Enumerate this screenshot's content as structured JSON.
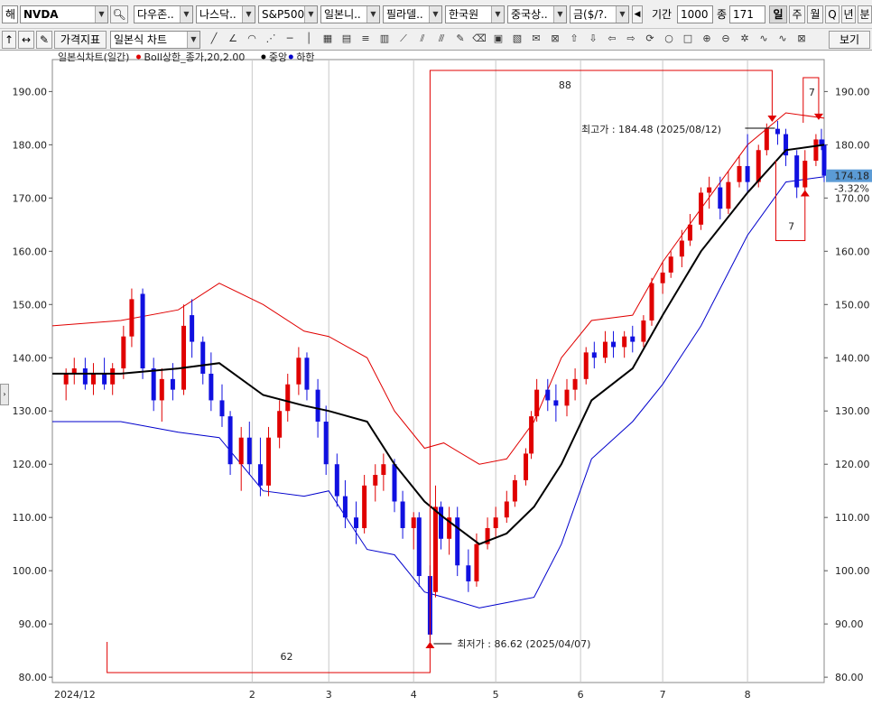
{
  "toolbar": {
    "prefix": "해",
    "symbol": "NVDA",
    "index_dropdowns": [
      "다우존..",
      "나스닥..",
      "S&P500",
      "일본니..",
      "필라델..",
      "한국원",
      "중국상..",
      "금($/?."
    ],
    "period_label": "기간",
    "period_value": "1000",
    "count_label": "종",
    "count_value": "171",
    "timeframes": [
      "일",
      "주",
      "월",
      "Q",
      "년",
      "분"
    ],
    "selected_timeframe": "일",
    "indicator_button": "가격지표",
    "chart_type": "일본식 차트",
    "view_button": "보기"
  },
  "chart_data": {
    "type": "candlestick",
    "legend_title": "일본식차트(일간)",
    "legend": [
      {
        "name": "Boll상한_종가,20,2.00",
        "color": "#e00000"
      },
      {
        "name": "중앙",
        "color": "#000000"
      },
      {
        "name": "하한",
        "color": "#0000cc"
      }
    ],
    "ylim": [
      79,
      196
    ],
    "y_ticks": [
      "190.00",
      "180.00",
      "170.00",
      "160.00",
      "150.00",
      "140.00",
      "130.00",
      "120.00",
      "110.00",
      "100.00",
      "90.00",
      "80.00"
    ],
    "x_tick_labels": [
      "2024/12",
      "2",
      "3",
      "4",
      "5",
      "6",
      "7",
      "8"
    ],
    "x_tick_dates": [
      "2024-12-01",
      "2025-02-01",
      "2025-03-01",
      "2025-04-01",
      "2025-05-01",
      "2025-06-01",
      "2025-07-01",
      "2025-08-01"
    ],
    "x_range": [
      "2024-11-20",
      "2025-08-29"
    ],
    "last_price": "174.18",
    "last_change": "-3.32%",
    "last_price_value": 174.18,
    "colors": {
      "up": "#e00000",
      "down": "#1010e0",
      "mid": "#000000",
      "upper": "#e00000",
      "lower": "#0000cc",
      "price_box": "#5b9bd5",
      "change": "#3a5fcd"
    },
    "annotations": {
      "high_label": "최고가 : 184.48 (2025/08/12)",
      "high_value": 184.48,
      "high_date": "2025-08-12",
      "low_label": "최저가 : 86.62 (2025/04/07)",
      "low_value": 86.62,
      "low_date": "2025-04-07",
      "count_top": "88",
      "count_bottom": "62",
      "count_right_top": "7",
      "count_right_bottom": "7"
    },
    "bollinger": {
      "dates": [
        "2024-11-20",
        "2024-12-15",
        "2025-01-05",
        "2025-01-20",
        "2025-02-05",
        "2025-02-20",
        "2025-03-01",
        "2025-03-15",
        "2025-03-25",
        "2025-04-05",
        "2025-04-12",
        "2025-04-25",
        "2025-05-05",
        "2025-05-15",
        "2025-05-25",
        "2025-06-05",
        "2025-06-20",
        "2025-07-01",
        "2025-07-15",
        "2025-08-01",
        "2025-08-15",
        "2025-08-29"
      ],
      "upper": [
        146,
        147,
        149,
        154,
        150,
        145,
        144,
        140,
        130,
        123,
        124,
        120,
        121,
        128,
        140,
        147,
        148,
        158,
        168,
        180,
        186,
        185
      ],
      "middle": [
        137,
        137,
        138,
        139,
        133,
        131,
        130,
        128,
        120,
        113,
        110,
        105,
        107,
        112,
        120,
        132,
        138,
        148,
        160,
        171,
        179,
        180
      ],
      "lower": [
        128,
        128,
        126,
        125,
        115,
        114,
        115,
        104,
        103,
        96,
        95,
        93,
        94,
        95,
        105,
        121,
        128,
        135,
        146,
        163,
        173,
        174
      ]
    },
    "candles": [
      {
        "d": "2024-11-25",
        "o": 135,
        "h": 138,
        "l": 132,
        "c": 137
      },
      {
        "d": "2024-11-28",
        "o": 137,
        "h": 140,
        "l": 135,
        "c": 138
      },
      {
        "d": "2024-12-02",
        "o": 138,
        "h": 140,
        "l": 134,
        "c": 135
      },
      {
        "d": "2024-12-05",
        "o": 135,
        "h": 139,
        "l": 133,
        "c": 137
      },
      {
        "d": "2024-12-09",
        "o": 137,
        "h": 140,
        "l": 134,
        "c": 135
      },
      {
        "d": "2024-12-12",
        "o": 135,
        "h": 139,
        "l": 133,
        "c": 138
      },
      {
        "d": "2024-12-16",
        "o": 138,
        "h": 146,
        "l": 136,
        "c": 144
      },
      {
        "d": "2024-12-19",
        "o": 144,
        "h": 153,
        "l": 142,
        "c": 151
      },
      {
        "d": "2024-12-23",
        "o": 152,
        "h": 153,
        "l": 136,
        "c": 138
      },
      {
        "d": "2024-12-27",
        "o": 138,
        "h": 140,
        "l": 130,
        "c": 132
      },
      {
        "d": "2024-12-30",
        "o": 132,
        "h": 138,
        "l": 128,
        "c": 136
      },
      {
        "d": "2025-01-03",
        "o": 136,
        "h": 139,
        "l": 132,
        "c": 134
      },
      {
        "d": "2025-01-07",
        "o": 134,
        "h": 150,
        "l": 133,
        "c": 146
      },
      {
        "d": "2025-01-10",
        "o": 148,
        "h": 151,
        "l": 140,
        "c": 143
      },
      {
        "d": "2025-01-14",
        "o": 143,
        "h": 144,
        "l": 135,
        "c": 137
      },
      {
        "d": "2025-01-17",
        "o": 137,
        "h": 141,
        "l": 130,
        "c": 132
      },
      {
        "d": "2025-01-21",
        "o": 132,
        "h": 135,
        "l": 127,
        "c": 129
      },
      {
        "d": "2025-01-24",
        "o": 129,
        "h": 130,
        "l": 118,
        "c": 120
      },
      {
        "d": "2025-01-28",
        "o": 120,
        "h": 127,
        "l": 115,
        "c": 125
      },
      {
        "d": "2025-01-31",
        "o": 125,
        "h": 128,
        "l": 118,
        "c": 120
      },
      {
        "d": "2025-02-04",
        "o": 120,
        "h": 125,
        "l": 114,
        "c": 116
      },
      {
        "d": "2025-02-07",
        "o": 116,
        "h": 127,
        "l": 114,
        "c": 125
      },
      {
        "d": "2025-02-11",
        "o": 125,
        "h": 132,
        "l": 123,
        "c": 130
      },
      {
        "d": "2025-02-14",
        "o": 130,
        "h": 137,
        "l": 128,
        "c": 135
      },
      {
        "d": "2025-02-18",
        "o": 135,
        "h": 142,
        "l": 133,
        "c": 140
      },
      {
        "d": "2025-02-21",
        "o": 140,
        "h": 141,
        "l": 132,
        "c": 134
      },
      {
        "d": "2025-02-25",
        "o": 134,
        "h": 136,
        "l": 125,
        "c": 128
      },
      {
        "d": "2025-02-28",
        "o": 128,
        "h": 131,
        "l": 118,
        "c": 120
      },
      {
        "d": "2025-03-04",
        "o": 120,
        "h": 122,
        "l": 112,
        "c": 114
      },
      {
        "d": "2025-03-07",
        "o": 114,
        "h": 117,
        "l": 108,
        "c": 110
      },
      {
        "d": "2025-03-11",
        "o": 110,
        "h": 113,
        "l": 105,
        "c": 108
      },
      {
        "d": "2025-03-14",
        "o": 108,
        "h": 118,
        "l": 107,
        "c": 116
      },
      {
        "d": "2025-03-18",
        "o": 116,
        "h": 120,
        "l": 113,
        "c": 118
      },
      {
        "d": "2025-03-21",
        "o": 118,
        "h": 122,
        "l": 115,
        "c": 120
      },
      {
        "d": "2025-03-25",
        "o": 120,
        "h": 121,
        "l": 111,
        "c": 113
      },
      {
        "d": "2025-03-28",
        "o": 113,
        "h": 115,
        "l": 106,
        "c": 108
      },
      {
        "d": "2025-04-01",
        "o": 108,
        "h": 111,
        "l": 104,
        "c": 110
      },
      {
        "d": "2025-04-03",
        "o": 110,
        "h": 111,
        "l": 97,
        "c": 99
      },
      {
        "d": "2025-04-07",
        "o": 99,
        "h": 101,
        "l": 86.62,
        "c": 88
      },
      {
        "d": "2025-04-09",
        "o": 96,
        "h": 116,
        "l": 95,
        "c": 112
      },
      {
        "d": "2025-04-11",
        "o": 112,
        "h": 113,
        "l": 104,
        "c": 106
      },
      {
        "d": "2025-04-14",
        "o": 106,
        "h": 112,
        "l": 103,
        "c": 110
      },
      {
        "d": "2025-04-17",
        "o": 110,
        "h": 112,
        "l": 99,
        "c": 101
      },
      {
        "d": "2025-04-21",
        "o": 101,
        "h": 104,
        "l": 96,
        "c": 98
      },
      {
        "d": "2025-04-24",
        "o": 98,
        "h": 107,
        "l": 97,
        "c": 105
      },
      {
        "d": "2025-04-28",
        "o": 105,
        "h": 110,
        "l": 104,
        "c": 108
      },
      {
        "d": "2025-05-01",
        "o": 108,
        "h": 112,
        "l": 106,
        "c": 110
      },
      {
        "d": "2025-05-05",
        "o": 110,
        "h": 115,
        "l": 109,
        "c": 113
      },
      {
        "d": "2025-05-08",
        "o": 113,
        "h": 118,
        "l": 112,
        "c": 117
      },
      {
        "d": "2025-05-12",
        "o": 117,
        "h": 123,
        "l": 116,
        "c": 122
      },
      {
        "d": "2025-05-14",
        "o": 122,
        "h": 130,
        "l": 121,
        "c": 129
      },
      {
        "d": "2025-05-16",
        "o": 129,
        "h": 136,
        "l": 128,
        "c": 134
      },
      {
        "d": "2025-05-20",
        "o": 134,
        "h": 136,
        "l": 130,
        "c": 132
      },
      {
        "d": "2025-05-23",
        "o": 132,
        "h": 135,
        "l": 128,
        "c": 131
      },
      {
        "d": "2025-05-27",
        "o": 131,
        "h": 136,
        "l": 129,
        "c": 134
      },
      {
        "d": "2025-05-30",
        "o": 134,
        "h": 138,
        "l": 132,
        "c": 136
      },
      {
        "d": "2025-06-03",
        "o": 136,
        "h": 142,
        "l": 135,
        "c": 141
      },
      {
        "d": "2025-06-06",
        "o": 141,
        "h": 143,
        "l": 138,
        "c": 140
      },
      {
        "d": "2025-06-10",
        "o": 140,
        "h": 145,
        "l": 139,
        "c": 143
      },
      {
        "d": "2025-06-13",
        "o": 143,
        "h": 145,
        "l": 140,
        "c": 142
      },
      {
        "d": "2025-06-17",
        "o": 142,
        "h": 145,
        "l": 140,
        "c": 144
      },
      {
        "d": "2025-06-20",
        "o": 144,
        "h": 146,
        "l": 141,
        "c": 143
      },
      {
        "d": "2025-06-24",
        "o": 143,
        "h": 148,
        "l": 142,
        "c": 147
      },
      {
        "d": "2025-06-27",
        "o": 147,
        "h": 155,
        "l": 146,
        "c": 154
      },
      {
        "d": "2025-07-01",
        "o": 154,
        "h": 158,
        "l": 152,
        "c": 156
      },
      {
        "d": "2025-07-04",
        "o": 156,
        "h": 160,
        "l": 155,
        "c": 159
      },
      {
        "d": "2025-07-08",
        "o": 159,
        "h": 164,
        "l": 157,
        "c": 162
      },
      {
        "d": "2025-07-11",
        "o": 162,
        "h": 167,
        "l": 161,
        "c": 165
      },
      {
        "d": "2025-07-15",
        "o": 165,
        "h": 172,
        "l": 164,
        "c": 171
      },
      {
        "d": "2025-07-18",
        "o": 171,
        "h": 174,
        "l": 168,
        "c": 172
      },
      {
        "d": "2025-07-22",
        "o": 172,
        "h": 174,
        "l": 166,
        "c": 168
      },
      {
        "d": "2025-07-25",
        "o": 168,
        "h": 175,
        "l": 167,
        "c": 173
      },
      {
        "d": "2025-07-29",
        "o": 173,
        "h": 178,
        "l": 172,
        "c": 176
      },
      {
        "d": "2025-08-01",
        "o": 176,
        "h": 182,
        "l": 171,
        "c": 173
      },
      {
        "d": "2025-08-05",
        "o": 173,
        "h": 180,
        "l": 172,
        "c": 179
      },
      {
        "d": "2025-08-08",
        "o": 179,
        "h": 184,
        "l": 178,
        "c": 183
      },
      {
        "d": "2025-08-12",
        "o": 183,
        "h": 184.48,
        "l": 180,
        "c": 182
      },
      {
        "d": "2025-08-15",
        "o": 182,
        "h": 183,
        "l": 176,
        "c": 178
      },
      {
        "d": "2025-08-19",
        "o": 178,
        "h": 179,
        "l": 170,
        "c": 172
      },
      {
        "d": "2025-08-22",
        "o": 172,
        "h": 179,
        "l": 171,
        "c": 177
      },
      {
        "d": "2025-08-26",
        "o": 177,
        "h": 182,
        "l": 176,
        "c": 181
      },
      {
        "d": "2025-08-28",
        "o": 181,
        "h": 183,
        "l": 179,
        "c": 180
      },
      {
        "d": "2025-08-29",
        "o": 180,
        "h": 181,
        "l": 173,
        "c": 174.18
      }
    ]
  }
}
